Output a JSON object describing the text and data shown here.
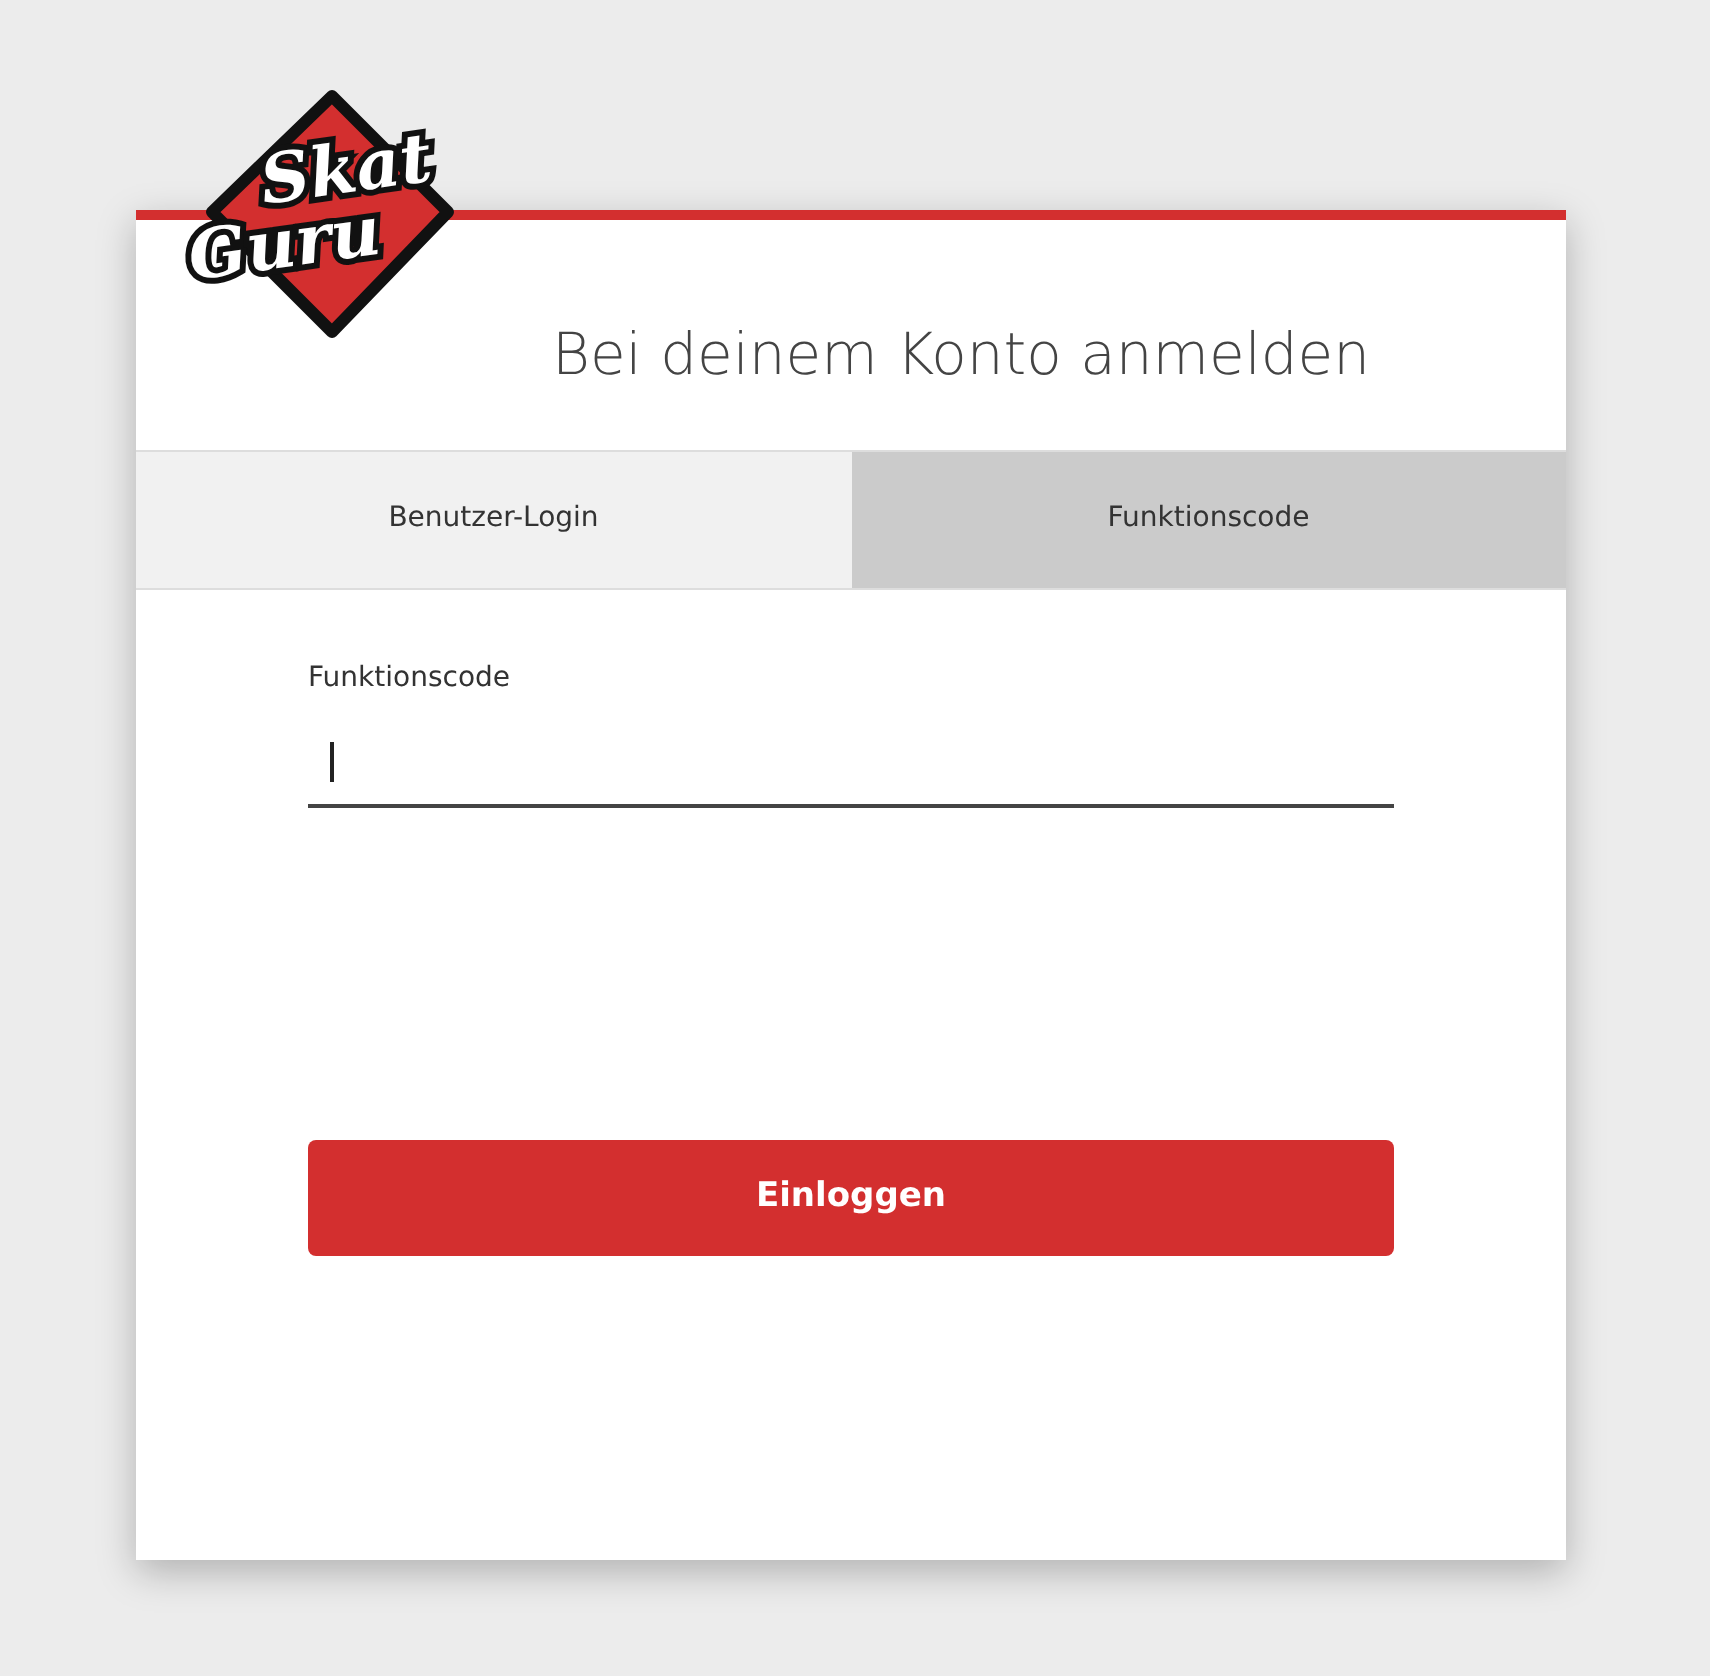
{
  "logo": {
    "line_1": "Skat",
    "line_2": "Guru"
  },
  "title": "Bei deinem Konto anmelden",
  "tabs": [
    {
      "label": "Benutzer-Login",
      "selected": false
    },
    {
      "label": "Funktionscode",
      "selected": true
    }
  ],
  "field": {
    "label": "Funktionscode",
    "focused": true
  },
  "button": "Einloggen"
}
